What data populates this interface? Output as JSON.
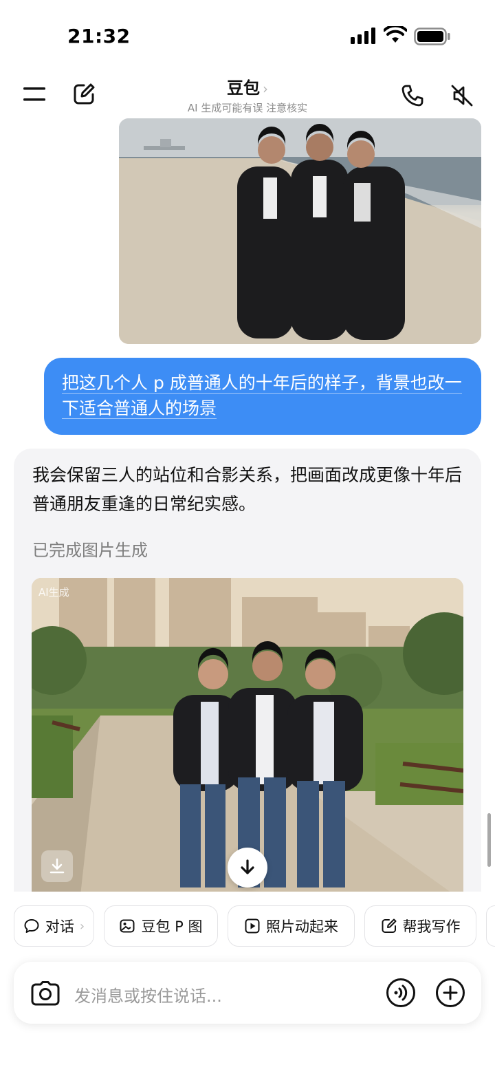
{
  "status_bar": {
    "time": "21:32"
  },
  "header": {
    "title": "豆包",
    "subtitle": "AI 生成可能有误 注意核实"
  },
  "chat": {
    "user_message": "把这几个人 p 成普通人的十年后的样子，背景也改一下适合普通人的场景",
    "ai_message": "我会保留三人的站位和合影关系，把画面改成更像十年后普通朋友重逢的日常纪实感。",
    "ai_status": "已完成图片生成",
    "image_watermark": "AI生成"
  },
  "quick_actions": [
    "对话",
    "豆包 P 图",
    "照片动起来",
    "帮我写作"
  ],
  "input": {
    "placeholder": "发消息或按住说话..."
  }
}
